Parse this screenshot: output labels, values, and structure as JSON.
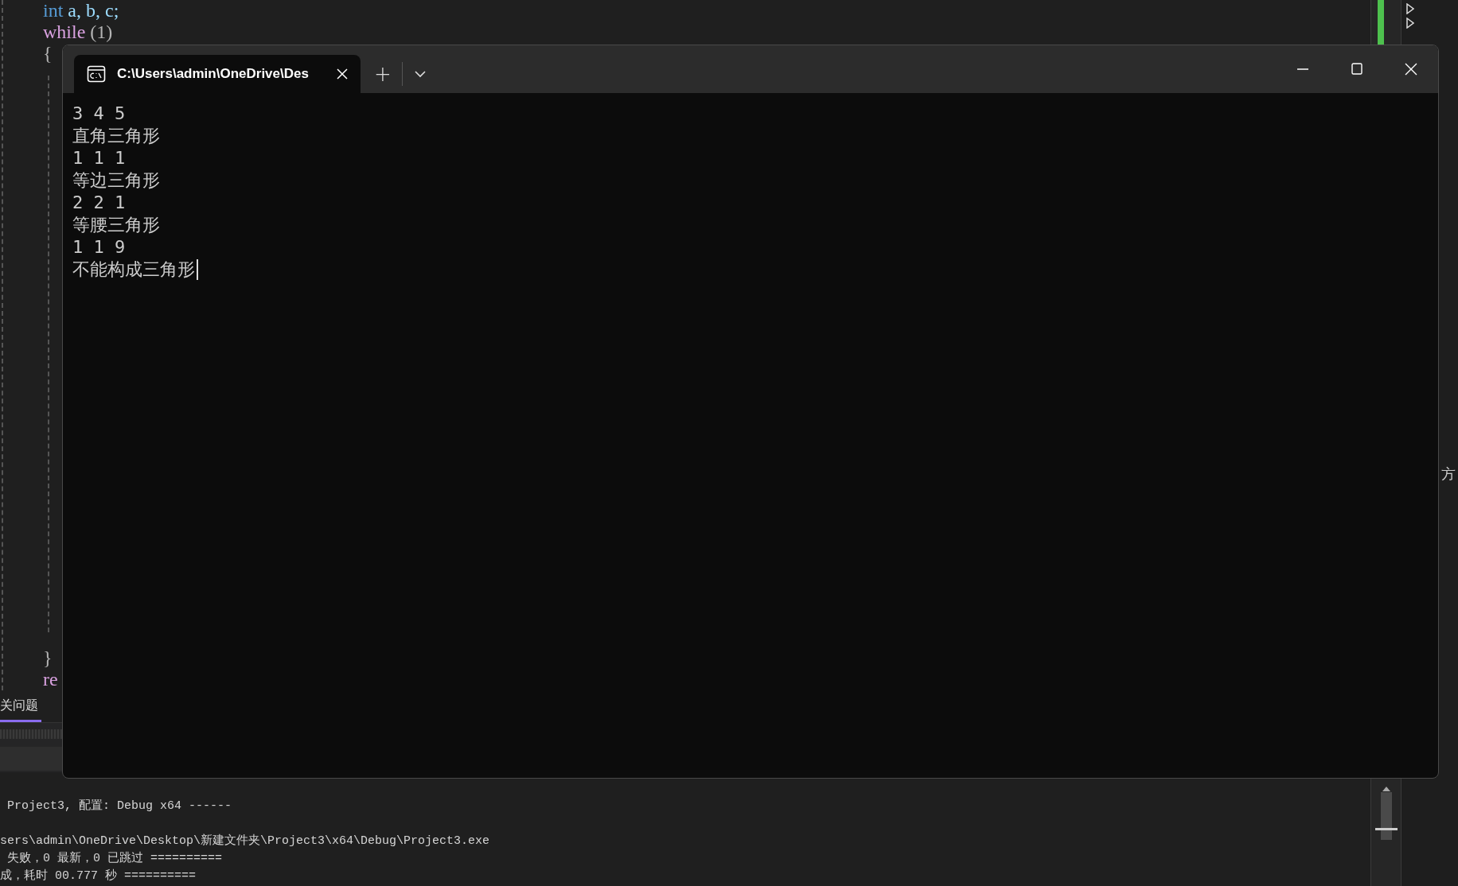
{
  "editor": {
    "code_top": [
      [
        {
          "text": "int",
          "kind": "keyword"
        },
        {
          "text": " a, b, c;",
          "kind": "variable"
        }
      ],
      [
        {
          "text": "while",
          "kind": "control"
        },
        {
          "text": " (1)",
          "kind": "plain"
        }
      ],
      [
        {
          "text": "{",
          "kind": "plain"
        }
      ]
    ],
    "code_bottom": [
      [
        {
          "text": "}",
          "kind": "plain"
        }
      ],
      [
        {
          "text": "re",
          "kind": "control"
        }
      ]
    ]
  },
  "panel_tab": {
    "label": "关问题",
    "selected": true
  },
  "output": {
    "lines": [
      " Project3, 配置: Debug x64 ------",
      "sers\\admin\\OneDrive\\Desktop\\新建文件夹\\Project3\\x64\\Debug\\Project3.exe",
      " 失败，0 最新，0 已跳过 ==========",
      "成，耗时 00.777 秒 =========="
    ]
  },
  "side_panel": {
    "label": "方"
  },
  "terminal": {
    "tabs": [
      {
        "title": "C:\\Users\\admin\\OneDrive\\Des",
        "selected": true
      }
    ],
    "new_tab": "+",
    "lines": [
      "3 4 5",
      "直角三角形",
      "1 1 1",
      "等边三角形",
      "2 2 1",
      "等腰三角形",
      "1 1 9",
      "不能构成三角形"
    ]
  }
}
